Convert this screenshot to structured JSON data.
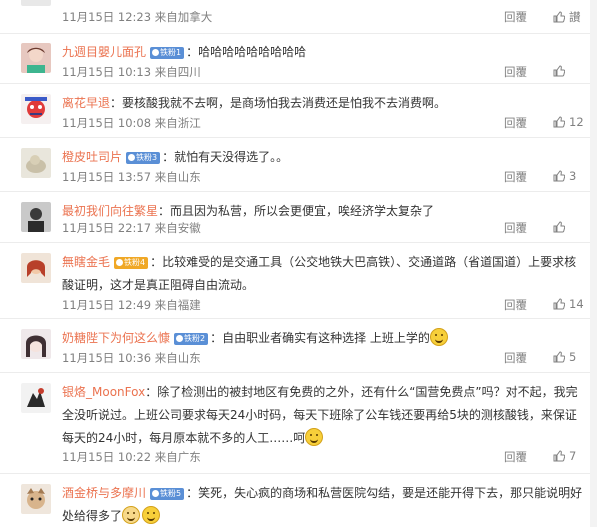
{
  "top": {
    "meta": "11月15日 12:23 来自加拿大",
    "reply": "回覆",
    "like": "讃"
  },
  "comments": [
    {
      "user": "九週目嬰儿面孔",
      "badge": "铁粉1",
      "badge_style": "blue",
      "text_lines": [
        "：哈哈哈哈哈哈哈哈哈"
      ],
      "meta": "11月15日 10:13 来自四川",
      "reply": "回覆",
      "like": ""
    },
    {
      "user": "离花早退",
      "badge": "",
      "text_lines": [
        "：要核酸我就不去啊，是商场怕我去消费还是怕我不去消费啊。"
      ],
      "meta": "11月15日 10:08 来自浙江",
      "reply": "回覆",
      "like": "12"
    },
    {
      "user": "橙皮吐司片",
      "badge": "铁粉3",
      "badge_style": "blue",
      "text_lines": [
        "：就怕有天没得选了。。"
      ],
      "meta": "11月15日 13:57 来自山东",
      "reply": "回覆",
      "like": "3"
    },
    {
      "user": "最初我们向往繁星",
      "badge": "",
      "text_lines": [
        "：而且因为私营，所以会更便宜，唉经济学太复杂了"
      ],
      "meta": "11月15日 22:17 来自安徽",
      "reply": "回覆",
      "like": ""
    },
    {
      "user": "無瞎金毛",
      "badge": "铁粉4",
      "badge_style": "gold",
      "text_lines": [
        "：比较难受的是交通工具（公交地铁大巴高铁）、交通道路（省道国道）上要求核",
        "酸证明，这才是真正阻碍自由流动。"
      ],
      "meta": "11月15日 12:49 来自福建",
      "reply": "回覆",
      "like": "14"
    },
    {
      "user": "奶糖陛下为何这么慷",
      "badge": "铁粉2",
      "badge_style": "blue",
      "text_lines": [
        "：自由职业者确实有这种选择 上班上学的"
      ],
      "meta": "11月15日 10:36 来自山东",
      "reply": "回覆",
      "like": "5"
    },
    {
      "user": "银烙_MoonFox",
      "badge": "",
      "text_lines": [
        "：除了检测出的被封地区有免费的之外，还有什么“国营免费点”吗？对不起，我完",
        "全没听说过。上班公司要求每天24小时码，每天下班除了公车钱还要再给5块的测核酸钱，来保证",
        "每天的24小时，每月原本就不多的人工……呵"
      ],
      "meta": "11月15日 10:22 来自广东",
      "reply": "回覆",
      "like": "7"
    },
    {
      "user": "酒金桥与多摩川",
      "badge": "铁粉5",
      "badge_style": "blue",
      "text_lines": [
        "：笑死，失心疯的商场和私营医院勾结，要是还能开得下去，那只能说明好",
        "处给得多了"
      ],
      "meta": "",
      "reply": "",
      "like": ""
    }
  ]
}
